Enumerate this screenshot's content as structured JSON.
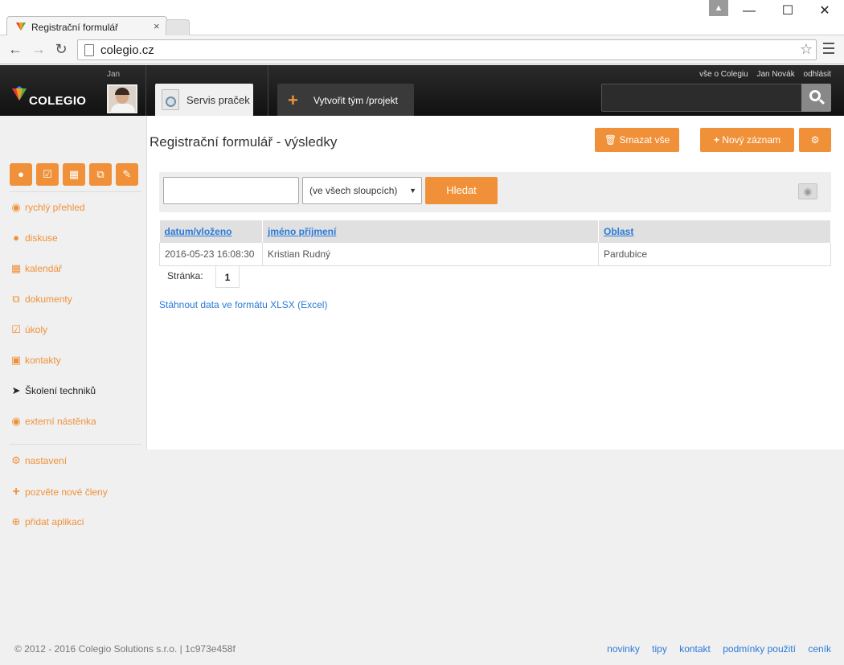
{
  "browser": {
    "tab_title": "Registrační formulář",
    "tab_close": "×",
    "url": "colegio.cz",
    "window_min": "—",
    "window_max": "☐",
    "window_close": "✕"
  },
  "header": {
    "logo_text": "COLEGIO",
    "user_label": "Jan",
    "group_tab_label": "Servis praček",
    "create_label": "Vytvořit tým /projekt",
    "links": [
      "vše o Colegiu",
      "Jan Novák",
      "odhlásit"
    ],
    "search_placeholder": ""
  },
  "sidebar": {
    "items": [
      {
        "label": "rychlý přehled",
        "icon": "eye-icon"
      },
      {
        "label": "diskuse",
        "icon": "chat-icon"
      },
      {
        "label": "kalendář",
        "icon": "calendar-icon"
      },
      {
        "label": "dokumenty",
        "icon": "documents-icon"
      },
      {
        "label": "úkoly",
        "icon": "checkbox-icon"
      },
      {
        "label": "kontakty",
        "icon": "book-icon"
      },
      {
        "label": "Školení techniků",
        "icon": "paper-plane-icon"
      },
      {
        "label": "externí nástěnka",
        "icon": "eye-icon"
      }
    ],
    "bottom_items": [
      {
        "label": "nastavení",
        "icon": "gears-icon"
      },
      {
        "label": "pozvěte nové členy",
        "icon": "plus-icon"
      },
      {
        "label": "přidat aplikaci",
        "icon": "plus-circle-icon"
      }
    ]
  },
  "main": {
    "title": "Registrační formulář - výsledky",
    "delete_all_label": "Smazat vše",
    "new_record_label": "Nový záznam",
    "filter": {
      "input_value": "",
      "column_select": "(ve všech sloupcích)",
      "search_label": "Hledat"
    },
    "table": {
      "columns": [
        "datum/vloženo",
        "jméno příjmení",
        "Oblast"
      ],
      "rows": [
        [
          "2016-05-23 16:08:30",
          "Kristian Rudný",
          "Pardubice"
        ]
      ]
    },
    "pager_label": "Stránka:",
    "page_number": "1",
    "download_link": "Stáhnout data ve formátu XLSX (Excel)"
  },
  "footer": {
    "copyright": "© 2012 - 2016 Colegio Solutions s.r.o. | 1c973e458f",
    "links": [
      "novinky",
      "tipy",
      "kontakt",
      "podmínky použití",
      "ceník"
    ]
  },
  "colors": {
    "accent": "#f0913a",
    "link": "#2a7ad8",
    "header_bg": "#1b1b1b"
  }
}
